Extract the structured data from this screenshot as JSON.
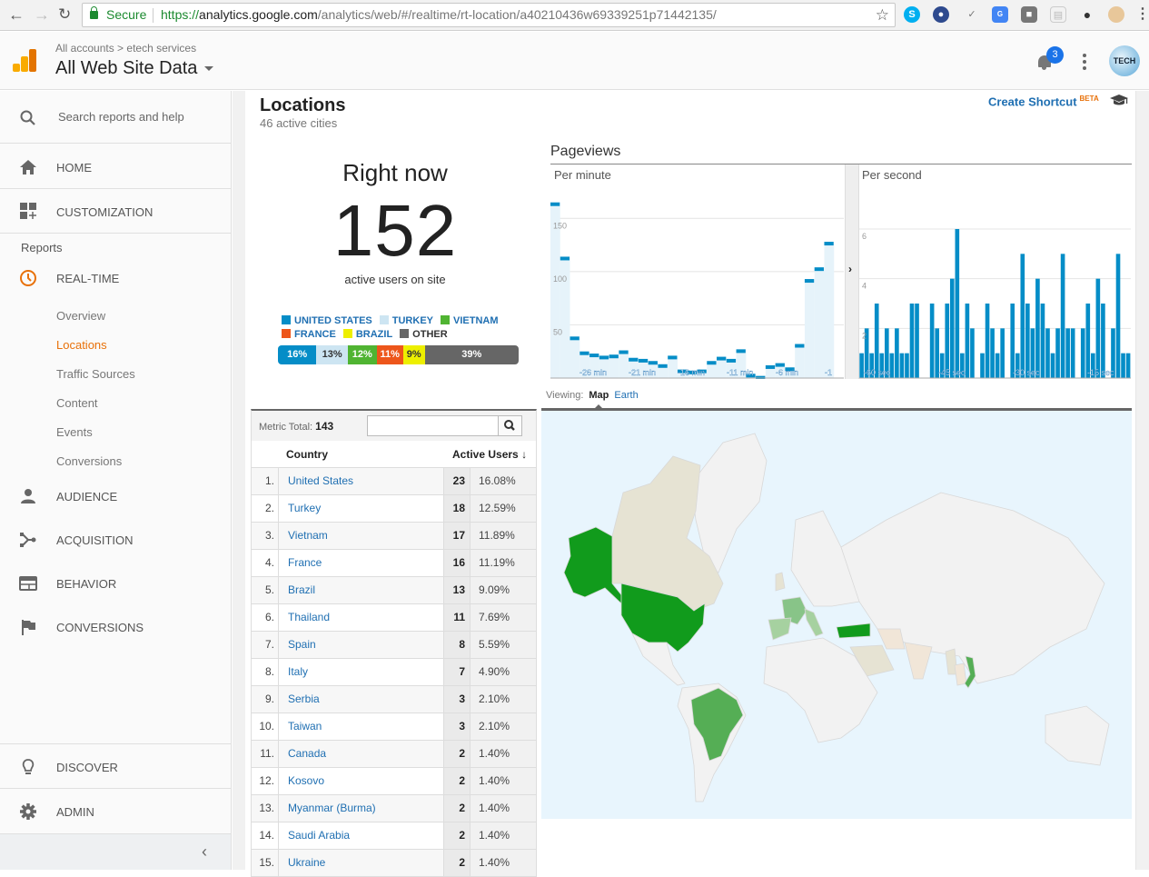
{
  "browser": {
    "secure_label": "Secure",
    "url_scheme": "https://",
    "url_host": "analytics.google.com",
    "url_path": "/analytics/web/#/realtime/rt-location/a40210436w69339251p71442135/",
    "extensions": [
      "skype-icon",
      "extension-person-icon",
      "checkmark-icon",
      "google-translate-icon",
      "shield-extension-icon",
      "grid-extension-icon",
      "evernote-icon",
      "palette-icon"
    ]
  },
  "header": {
    "breadcrumb_root": "All accounts",
    "breadcrumb_sep": ">",
    "breadcrumb_account": "etech services",
    "property": "All Web Site Data",
    "notification_count": "3",
    "avatar_text": "TECH"
  },
  "sidebar": {
    "search_placeholder": "Search reports and help",
    "home": "HOME",
    "customization": "CUSTOMIZATION",
    "reports_label": "Reports",
    "realtime": "REAL-TIME",
    "realtime_items": [
      "Overview",
      "Locations",
      "Traffic Sources",
      "Content",
      "Events",
      "Conversions"
    ],
    "active_item": "Locations",
    "audience": "AUDIENCE",
    "acquisition": "ACQUISITION",
    "behavior": "BEHAVIOR",
    "conversions": "CONVERSIONS",
    "discover": "DISCOVER",
    "admin": "ADMIN"
  },
  "page": {
    "title": "Locations",
    "subtitle": "46 active cities",
    "create_shortcut": "Create Shortcut",
    "beta": "BETA"
  },
  "summary": {
    "right_now": "Right now",
    "active_users": "152",
    "active_users_label": "active users on site",
    "legend": [
      {
        "label": "UNITED STATES",
        "color": "#058dc7",
        "pct": "16%",
        "value": 16,
        "text_color": "#ffffff"
      },
      {
        "label": "TURKEY",
        "color": "#cde5f2",
        "pct": "13%",
        "value": 13,
        "text_color": "#333333"
      },
      {
        "label": "VIETNAM",
        "color": "#50b432",
        "pct": "12%",
        "value": 12,
        "text_color": "#ffffff"
      },
      {
        "label": "FRANCE",
        "color": "#ed561b",
        "pct": "11%",
        "value": 11,
        "text_color": "#ffffff"
      },
      {
        "label": "BRAZIL",
        "color": "#edef00",
        "pct": "9%",
        "value": 9,
        "text_color": "#333333"
      },
      {
        "label": "OTHER",
        "color": "#666666",
        "pct": "39%",
        "value": 39,
        "text_color": "#ffffff"
      }
    ]
  },
  "pageviews": {
    "title": "Pageviews",
    "per_minute_label": "Per minute",
    "per_second_label": "Per second"
  },
  "chart_data": [
    {
      "type": "bar",
      "title": "Pageviews Per minute",
      "ylim": [
        0,
        175
      ],
      "yticks": [
        50,
        100,
        150
      ],
      "xtick_labels": [
        "-26 min",
        "-21 min",
        "-16 min",
        "-11 min",
        "-6 min",
        "-1"
      ],
      "x": [
        -30,
        -29,
        -28,
        -27,
        -26,
        -25,
        -24,
        -23,
        -22,
        -21,
        -20,
        -19,
        -18,
        -17,
        -16,
        -15,
        -14,
        -13,
        -12,
        -11,
        -10,
        -9,
        -8,
        -7,
        -6,
        -5,
        -4,
        -3,
        -2,
        -1
      ],
      "values": [
        165,
        114,
        39,
        25,
        23,
        21,
        22,
        26,
        19,
        18,
        16,
        13,
        21,
        8,
        7,
        8,
        16,
        20,
        18,
        27,
        4,
        2,
        12,
        14,
        10,
        32,
        93,
        104,
        128,
        0
      ],
      "bar_color": "#058dc7",
      "grid": true
    },
    {
      "type": "bar",
      "title": "Pageviews Per second",
      "ylim": [
        0,
        7.5
      ],
      "yticks": [
        2,
        4,
        6
      ],
      "xtick_labels": [
        "-60 sec",
        "-45 sec",
        "-30 sec",
        "-15 sec"
      ],
      "values": [
        1,
        2,
        1,
        3,
        1,
        2,
        1,
        2,
        1,
        1,
        3,
        3,
        0,
        0,
        3,
        2,
        1,
        3,
        4,
        6,
        1,
        3,
        2,
        0,
        1,
        3,
        2,
        1,
        2,
        0,
        3,
        1,
        5,
        3,
        2,
        4,
        3,
        2,
        1,
        2,
        5,
        2,
        2,
        0,
        2,
        3,
        1,
        4,
        3,
        0,
        2,
        5,
        1,
        1
      ],
      "bar_color": "#058dc7",
      "grid": true
    }
  ],
  "table": {
    "metric_total_label": "Metric Total:",
    "metric_total": "143",
    "search_value": "",
    "col_country": "Country",
    "col_active": "Active Users",
    "rows": [
      {
        "rank": "1.",
        "country": "United States",
        "users": "23",
        "pct": "16.08%"
      },
      {
        "rank": "2.",
        "country": "Turkey",
        "users": "18",
        "pct": "12.59%"
      },
      {
        "rank": "3.",
        "country": "Vietnam",
        "users": "17",
        "pct": "11.89%"
      },
      {
        "rank": "4.",
        "country": "France",
        "users": "16",
        "pct": "11.19%"
      },
      {
        "rank": "5.",
        "country": "Brazil",
        "users": "13",
        "pct": "9.09%"
      },
      {
        "rank": "6.",
        "country": "Thailand",
        "users": "11",
        "pct": "7.69%"
      },
      {
        "rank": "7.",
        "country": "Spain",
        "users": "8",
        "pct": "5.59%"
      },
      {
        "rank": "8.",
        "country": "Italy",
        "users": "7",
        "pct": "4.90%"
      },
      {
        "rank": "9.",
        "country": "Serbia",
        "users": "3",
        "pct": "2.10%"
      },
      {
        "rank": "10.",
        "country": "Taiwan",
        "users": "3",
        "pct": "2.10%"
      },
      {
        "rank": "11.",
        "country": "Canada",
        "users": "2",
        "pct": "1.40%"
      },
      {
        "rank": "12.",
        "country": "Kosovo",
        "users": "2",
        "pct": "1.40%"
      },
      {
        "rank": "13.",
        "country": "Myanmar (Burma)",
        "users": "2",
        "pct": "1.40%"
      },
      {
        "rank": "14.",
        "country": "Saudi Arabia",
        "users": "2",
        "pct": "1.40%"
      },
      {
        "rank": "15.",
        "country": "Ukraine",
        "users": "2",
        "pct": "1.40%"
      }
    ]
  },
  "map": {
    "viewing_label": "Viewing:",
    "map_tab": "Map",
    "earth_tab": "Earth",
    "colors": {
      "ocean": "#e8f5fd",
      "land": "#f2f2f2",
      "low": "#e6e3d3",
      "high": "#119b1c",
      "mid": "#55ae55",
      "light": "#88c488"
    }
  }
}
